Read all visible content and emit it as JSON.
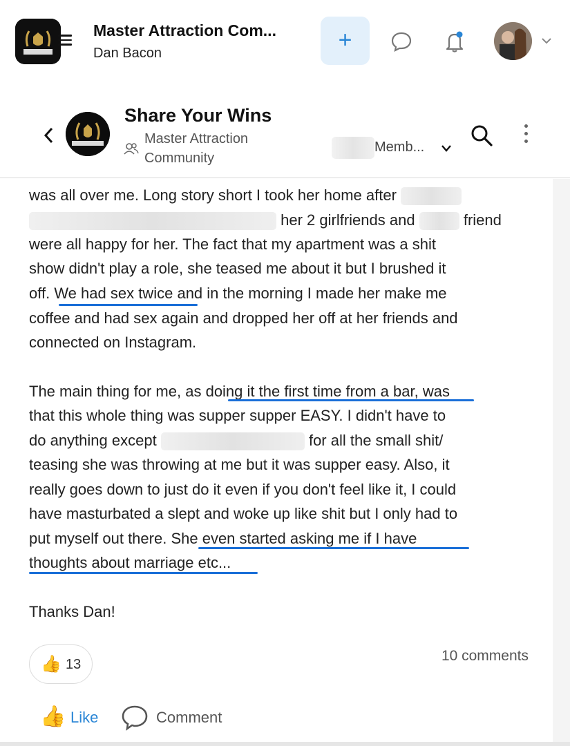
{
  "topbar": {
    "app_title": "Master Attraction Com...",
    "app_subtitle": "Dan Bacon",
    "plus_label": "+",
    "accent": "#2a86d6",
    "logo_text": "MASTER ATTRACTION COMMUNITY"
  },
  "channel": {
    "title": "Share Your Wins",
    "subtitle": "Master Attraction Community",
    "members_label": "Memb..."
  },
  "post": {
    "lines": [
      "was all over me. Long story short I took her home after",
      "her 2 girlfriends and",
      "friend",
      "were all happy for her. The fact that my apartment was a shit",
      "show didn't play a role, she teased me about it but I brushed it",
      "off.",
      "We had sex twice",
      "and in the morning I made her make me",
      "coffee and had sex again and dropped her off at her friends and",
      "connected on Instagram.",
      "The main thing for me, as",
      "doing it the first time from a bar,",
      "was",
      "that this whole thing was supper supper EASY. I didn't have to",
      "do anything except",
      "for all the small shit/",
      "teasing she was throwing at me but it was supper easy. Also, it",
      "really goes down to just do it even if you don't feel like it, I could",
      "have masturbated a slept and woke up like shit but I only had to",
      "put myself out there.",
      "She even started asking me if I have",
      "thoughts about marriage etc...",
      "Thanks Dan!"
    ],
    "highlight_color": "#1a6fd8"
  },
  "reactions": {
    "like_emoji": "👍",
    "count": "13",
    "comments": "10 comments"
  },
  "actions": {
    "like_label": "Like",
    "comment_label": "Comment"
  }
}
